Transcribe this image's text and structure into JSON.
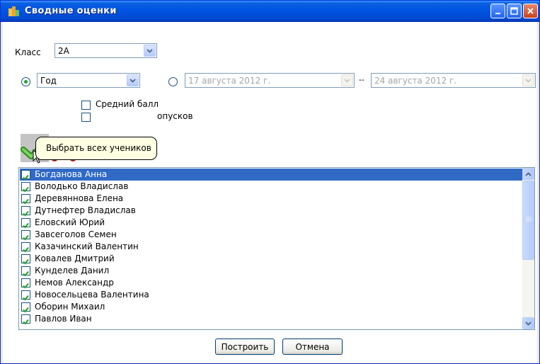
{
  "window": {
    "title": "Сводные оценки",
    "accent": "#0054E3"
  },
  "form": {
    "class_label": "Класс",
    "class_value": "2А",
    "period_value": "Год",
    "date_from": "17 августа 2012 г.",
    "date_sep": "--",
    "date_to": "24 августа 2012 г.",
    "checkbox_avg": "Средний балл",
    "checkbox_absence_partial": "опусков"
  },
  "tooltip": "Выбрать всех учеников",
  "icons": {
    "select_all": "check-icon",
    "deselect_all": "x-icon"
  },
  "students": [
    "Богданова Анна",
    "Володько Владислав",
    "Деревяннова Елена",
    "Дутнефтер Владислав",
    "Еловский Юрий",
    "Завсеголов Семен",
    "Казачинский Валентин",
    "Ковалев Дмитрий",
    "Кунделев Данил",
    "Немов Александр",
    "Новосельцева Валентина",
    "Оборин Михаил",
    "Павлов Иван"
  ],
  "buttons": {
    "build": "Построить",
    "cancel": "Отмена"
  }
}
